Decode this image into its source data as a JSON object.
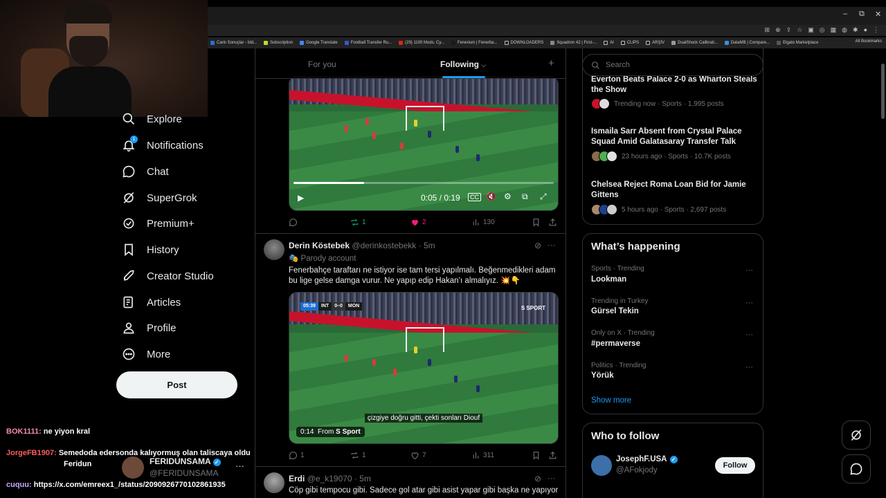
{
  "browser": {
    "window_controls": [
      "–",
      "⧉",
      "✕"
    ],
    "bookmarks": [
      "Canlı Sonuçlar - İdd...",
      "Subscription",
      "Google Translate",
      "Football Transfer Ru...",
      "(29) 1100 Mods. Cy...",
      "Fenerium | Fenerba...",
      "DOWNLOADERS",
      "Squadron 42 | First-...",
      "AI",
      "CLIPS",
      "ARŞİV",
      "DualShock Calibrati...",
      "DataMB | Compare...",
      "Elgato Marketplace"
    ],
    "all_bookmarks": "All Bookmarks"
  },
  "nav": {
    "explore": "Explore",
    "notifications": "Notifications",
    "notif_badge": "1",
    "chat": "Chat",
    "supergrok": "SuperGrok",
    "premium": "Premium+",
    "history": "History",
    "creator_studio": "Creator Studio",
    "articles": "Articles",
    "profile": "Profile",
    "more": "More",
    "post_button": "Post"
  },
  "stream_chat": [
    {
      "user": "BOK1111:",
      "text": "ne yiyon kral"
    },
    {
      "user": "JorgeFB1907:",
      "text": "Semedoda edersonda kalıyormuş olan taliscaya oldu",
      "text2": "Feridun"
    },
    {
      "user": "cuquu:",
      "text": "https://x.com/emreex1_/status/2090926770102861935"
    }
  ],
  "account": {
    "name": "FERIDUNSAMA",
    "handle": "@FERIDUNSAMA",
    "more": "···"
  },
  "timeline": {
    "tab_foryou": "For you",
    "tab_following": "Following",
    "posts": [
      {
        "video_time": "0:05 / 0:19",
        "progress": 0.27,
        "replies": "",
        "reposts": "1",
        "likes": "2",
        "views": "130"
      },
      {
        "name": "Derin Köstebek",
        "handle": "@derinkostebekk",
        "time": "· 5m",
        "badge": "Parody account",
        "text": "Fenerbahçe taraftarı ne istiyor ise tam tersi yapılmalı. Beğenmedikleri adam bu lige gelse damga vurur. Ne yapıp edip Hakan’ı almalıyız. 💥👇",
        "score_time": "05:39",
        "score_home": "INT",
        "score": "0–0",
        "score_away": "MON",
        "channel": "S SPORT",
        "subtitle": "çizgiye doğru gitti, çekti sonları Diouf",
        "from_time": "0:14",
        "from_label": "From",
        "from_source": "S Sport",
        "replies": "1",
        "reposts": "1",
        "likes": "7",
        "views": "311"
      },
      {
        "name": "Erdi",
        "handle": "@e_k19070",
        "time": "· 5m",
        "text": "Cöp gibi tempocu gibi. Sadece gol atar gibi asist yapar gibi başka ne yapıyor"
      }
    ]
  },
  "sidebar": {
    "search_placeholder": "Search",
    "news": [
      {
        "title": "Everton Beats Palace 2-0 as Wharton Steals the Show",
        "meta": "Trending now · Sports · 1,995 posts"
      },
      {
        "title": "Ismaila Sarr Absent from Crystal Palace Squad Amid Galatasaray Transfer Talk",
        "meta": "23 hours ago · Sports · 10.7K posts"
      },
      {
        "title": "Chelsea Reject Roma Loan Bid for Jamie Gittens",
        "meta": "5 hours ago · Sports · 2,697 posts"
      }
    ],
    "whats_happening": "What’s happening",
    "trends": [
      {
        "meta": "Sports · Trending",
        "name": "Lookman"
      },
      {
        "meta": "Trending in Turkey",
        "name": "Gürsel Tekin"
      },
      {
        "meta": "Only on X · Trending",
        "name": "#permaverse"
      },
      {
        "meta": "Politics · Trending",
        "name": "Yörük"
      }
    ],
    "show_more": "Show more",
    "who_to_follow": "Who to follow",
    "suggestion": {
      "name": "JosephF.USA",
      "handle": "@AFokjody",
      "follow": "Follow"
    }
  },
  "colors": {
    "accent": "#1d9bf0",
    "like": "#f91880",
    "repost": "#00ba7c",
    "bg": "#000000",
    "border": "#2f3336"
  }
}
